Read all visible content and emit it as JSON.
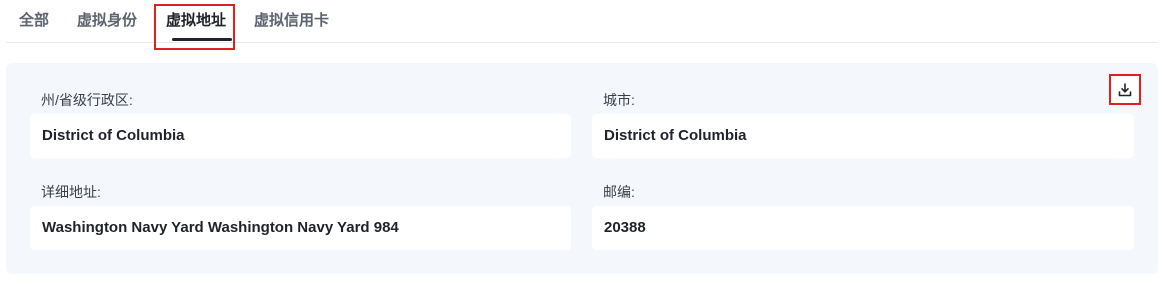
{
  "tabs": [
    {
      "label": "全部"
    },
    {
      "label": "虚拟身份"
    },
    {
      "label": "虚拟地址"
    },
    {
      "label": "虚拟信用卡"
    }
  ],
  "active_tab_index": 2,
  "fields": {
    "state": {
      "label": "州/省级行政区:",
      "value": "District of Columbia"
    },
    "city": {
      "label": "城市:",
      "value": "District of Columbia"
    },
    "address": {
      "label": "详细地址:",
      "value": "Washington Navy Yard Washington Navy Yard 984"
    },
    "zip": {
      "label": "邮编:",
      "value": "20388"
    }
  },
  "icons": {
    "download": "download-icon"
  },
  "colors": {
    "highlight": "#e02020",
    "panel_bg": "#f4f7fc"
  }
}
